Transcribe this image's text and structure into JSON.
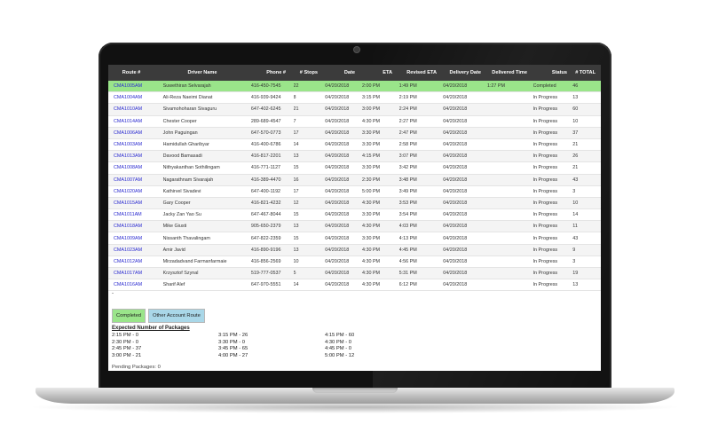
{
  "table": {
    "headers": [
      "Route #",
      "Driver Name",
      "Phone #",
      "# Stops",
      "Date",
      "ETA",
      "Revised ETA",
      "Delivery Date",
      "Delivered Time",
      "Status",
      "# TOTAL"
    ],
    "rows": [
      [
        "CMA1005AM",
        "Suwethiran Selvarajah",
        "416-450-7545",
        "22",
        "04/20/2018",
        "2:00 PM",
        "1:49 PM",
        "04/20/2018",
        "1:27 PM",
        "Completed",
        "46"
      ],
      [
        "CMA1004AM",
        "Ali-Reza Naeimi Dianat",
        "416-939-9424",
        "8",
        "04/20/2018",
        "3:15 PM",
        "2:19 PM",
        "04/20/2018",
        "",
        "In Progress",
        "13"
      ],
      [
        "CMA1010AM",
        "Sivamohoharan Sivaguru",
        "647-402-6245",
        "21",
        "04/20/2018",
        "3:00 PM",
        "2:24 PM",
        "04/20/2018",
        "",
        "In Progress",
        "60"
      ],
      [
        "CMA1014AM",
        "Chester Cooper",
        "289-689-4547",
        "7",
        "04/20/2018",
        "4:30 PM",
        "2:27 PM",
        "04/20/2018",
        "",
        "In Progress",
        "10"
      ],
      [
        "CMA1006AM",
        "John Paguingan",
        "647-570-0773",
        "17",
        "04/20/2018",
        "3:30 PM",
        "2:47 PM",
        "04/20/2018",
        "",
        "In Progress",
        "37"
      ],
      [
        "CMA1003AM",
        "Hamidullah Gharibyar",
        "416-400-6786",
        "14",
        "04/20/2018",
        "3:30 PM",
        "2:58 PM",
        "04/20/2018",
        "",
        "In Progress",
        "21"
      ],
      [
        "CMA1013AM",
        "Davood Bamasadi",
        "416-817-2201",
        "13",
        "04/20/2018",
        "4:15 PM",
        "3:07 PM",
        "04/20/2018",
        "",
        "In Progress",
        "26"
      ],
      [
        "CMA1008AM",
        "Nithyakanthan Sothilingam",
        "416-771-1127",
        "15",
        "04/20/2018",
        "3:30 PM",
        "3:42 PM",
        "04/20/2018",
        "",
        "In Progress",
        "21"
      ],
      [
        "CMA1007AM",
        "Nagarathnam Sivarajah",
        "416-389-4470",
        "16",
        "04/20/2018",
        "2:30 PM",
        "3:48 PM",
        "04/20/2018",
        "",
        "In Progress",
        "43"
      ],
      [
        "CMA1020AM",
        "Kathirvel Sivadevi",
        "647-400-1192",
        "17",
        "04/20/2018",
        "5:00 PM",
        "3:49 PM",
        "04/20/2018",
        "",
        "In Progress",
        "3"
      ],
      [
        "CMA1015AM",
        "Gary Cooper",
        "416-821-4232",
        "12",
        "04/20/2018",
        "4:30 PM",
        "3:53 PM",
        "04/20/2018",
        "",
        "In Progress",
        "10"
      ],
      [
        "CMA1011AM",
        "Jacky Zan Yao Su",
        "647-467-8044",
        "15",
        "04/20/2018",
        "3:30 PM",
        "3:54 PM",
        "04/20/2018",
        "",
        "In Progress",
        "14"
      ],
      [
        "CMA1018AM",
        "Mike Giusti",
        "905-650-2379",
        "13",
        "04/20/2018",
        "4:30 PM",
        "4:03 PM",
        "04/20/2018",
        "",
        "In Progress",
        "11"
      ],
      [
        "CMA1009AM",
        "Nissanth Thavalingam",
        "647-822-2359",
        "15",
        "04/20/2018",
        "3:30 PM",
        "4:13 PM",
        "04/20/2018",
        "",
        "In Progress",
        "43"
      ],
      [
        "CMA1023AM",
        "Amir Javid",
        "416-890-9196",
        "13",
        "04/20/2018",
        "4:30 PM",
        "4:45 PM",
        "04/20/2018",
        "",
        "In Progress",
        "9"
      ],
      [
        "CMA1012AM",
        "Mirzadadvand Farmanfarmaie",
        "416-856-2569",
        "10",
        "04/20/2018",
        "4:30 PM",
        "4:56 PM",
        "04/20/2018",
        "",
        "In Progress",
        "3"
      ],
      [
        "CMA1017AM",
        "Krzysztof Szynal",
        "519-777-0537",
        "5",
        "04/20/2018",
        "4:30 PM",
        "5:31 PM",
        "04/20/2018",
        "",
        "In Progress",
        "19"
      ],
      [
        "CMA1016AM",
        "Sharif Alef",
        "647-970-5551",
        "14",
        "04/20/2018",
        "4:30 PM",
        "6:12 PM",
        "04/20/2018",
        "",
        "In Progress",
        "13"
      ]
    ],
    "trailing_mark": "-"
  },
  "legend": {
    "completed_label": "Completed",
    "other_label": "Other Account Route"
  },
  "packages": {
    "title": "Expected Number of Packages",
    "entries": [
      "2:15 PM - 0",
      "3:15 PM - 26",
      "4:15 PM - 60",
      "2:30 PM - 0",
      "3:30 PM - 0",
      "4:30 PM - 0",
      "2:45 PM - 37",
      "3:45 PM - 65",
      "4:45 PM - 0",
      "3:00 PM - 21",
      "4:00 PM - 27",
      "5:00 PM - 12"
    ],
    "pending": "Pending Packages: 0"
  },
  "colors": {
    "completed": "#9ae58a",
    "other_account": "#a9d7e8",
    "header_bg": "#3b3b3b",
    "route_link": "#2a2ad0"
  }
}
